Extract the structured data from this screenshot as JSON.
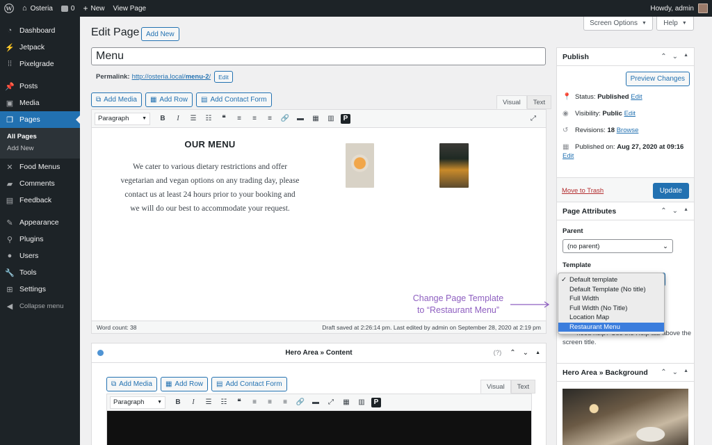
{
  "adminbar": {
    "site_name": "Osteria",
    "comments_count": "0",
    "new_label": "New",
    "view_page_label": "View Page",
    "howdy": "Howdy, admin"
  },
  "sidebar": {
    "items": [
      {
        "label": "Dashboard",
        "icon": "dashboard-icon"
      },
      {
        "label": "Jetpack",
        "icon": "jetpack-icon"
      },
      {
        "label": "Pixelgrade",
        "icon": "pixelgrade-icon"
      },
      {
        "label": "Posts",
        "icon": "pin-icon"
      },
      {
        "label": "Media",
        "icon": "media-icon"
      },
      {
        "label": "Pages",
        "icon": "pages-icon"
      },
      {
        "label": "Food Menus",
        "icon": "utensils-icon"
      },
      {
        "label": "Comments",
        "icon": "comment-icon"
      },
      {
        "label": "Feedback",
        "icon": "feedback-icon"
      },
      {
        "label": "Appearance",
        "icon": "brush-icon"
      },
      {
        "label": "Plugins",
        "icon": "plugin-icon"
      },
      {
        "label": "Users",
        "icon": "users-icon"
      },
      {
        "label": "Tools",
        "icon": "wrench-icon"
      },
      {
        "label": "Settings",
        "icon": "settings-icon"
      },
      {
        "label": "Collapse menu",
        "icon": "collapse-icon"
      }
    ],
    "submenu": [
      "All Pages",
      "Add New"
    ]
  },
  "header": {
    "title": "Edit Page",
    "add_new": "Add New",
    "screen_options": "Screen Options",
    "help": "Help"
  },
  "post": {
    "title": "Menu",
    "permalink_label": "Permalink:",
    "permalink_base": "http://osteria.local/",
    "permalink_slug": "menu-2",
    "permalink_end": "/",
    "edit_label": "Edit"
  },
  "editor": {
    "add_media": "Add Media",
    "add_row": "Add Row",
    "add_contact_form": "Add Contact Form",
    "tab_visual": "Visual",
    "tab_text": "Text",
    "format_select": "Paragraph",
    "content_heading": "OUR MENU",
    "content_text": "We cater to various dietary restrictions and offer vegetarian and vegan options on any trading day, please contact us at least 24 hours prior to your booking and we will do our best to accommodate your request.",
    "word_count": "Word count: 38",
    "draft_status": "Draft saved at 2:26:14 pm. Last edited by admin on September 28, 2020 at 2:19 pm"
  },
  "hero_box": {
    "title": "Hero Area » Content",
    "help": "(?)"
  },
  "publish": {
    "title": "Publish",
    "preview": "Preview Changes",
    "status_label": "Status:",
    "status_value": "Published",
    "visibility_label": "Visibility:",
    "visibility_value": "Public",
    "revisions_label": "Revisions:",
    "revisions_value": "18",
    "browse": "Browse",
    "published_on_label": "Published on:",
    "published_on_value": "Aug 27, 2020 at 09:16",
    "edit": "Edit",
    "trash": "Move to Trash",
    "update": "Update"
  },
  "page_attributes": {
    "title": "Page Attributes",
    "parent_label": "Parent",
    "parent_value": "(no parent)",
    "template_label": "Template",
    "help_text_line1": "need help? Use the Help tab above the",
    "help_text_line2": "screen title.",
    "options": [
      "Default template",
      "Default Template (No title)",
      "Full Width",
      "Full Width (No Title)",
      "Location Map",
      "Restaurant Menu"
    ],
    "selected_index": 0,
    "highlighted_index": 5
  },
  "hero_bg": {
    "title": "Hero Area » Background"
  },
  "annotation": {
    "line1": "Change Page Template",
    "line2": "to “Restaurant Menu”",
    "color": "#8e5fc0"
  },
  "colors": {
    "admin_bar": "#1d2327",
    "accent": "#2271b1",
    "trash": "#b32d2e"
  }
}
